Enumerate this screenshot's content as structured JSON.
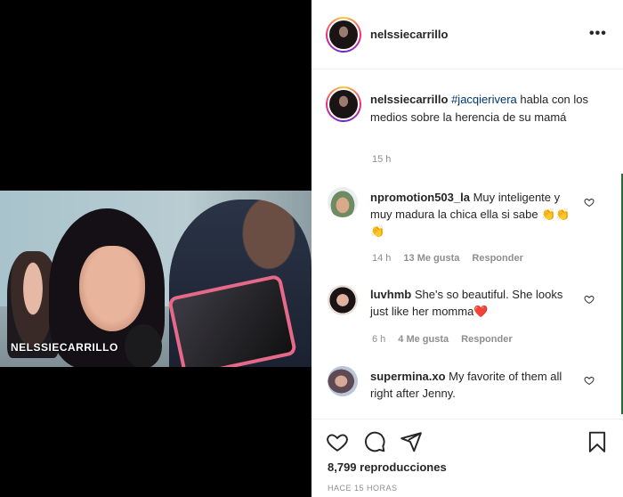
{
  "video": {
    "watermark": "NELSSIECARRILLO"
  },
  "post": {
    "author": "nelssiecarrillo",
    "more_label": "•••",
    "caption": {
      "username": "nelssiecarrillo",
      "hashtag": "#jacqierivera",
      "text": " habla con los medios sobre la herencia de su mamá",
      "time": "15 h"
    },
    "comments": [
      {
        "username": "npromotion503_la",
        "text": " Muy inteligente y muy madura la chica ella si sabe 👏👏👏",
        "time": "14 h",
        "likes": "13 Me gusta",
        "reply": "Responder"
      },
      {
        "username": "luvhmb",
        "text": " She's so beautiful. She looks just like her momma❤️",
        "time": "6 h",
        "likes": "4 Me gusta",
        "reply": "Responder"
      },
      {
        "username": "supermina.xo",
        "text": " My favorite of them all right after Jenny.",
        "time": "",
        "likes": "",
        "reply": ""
      }
    ],
    "views": "8,799 reproducciones",
    "posted_ago": "HACE 15 HORAS"
  },
  "icons": [
    "heart-icon",
    "comment-icon",
    "share-icon",
    "bookmark-icon",
    "more-icon"
  ]
}
